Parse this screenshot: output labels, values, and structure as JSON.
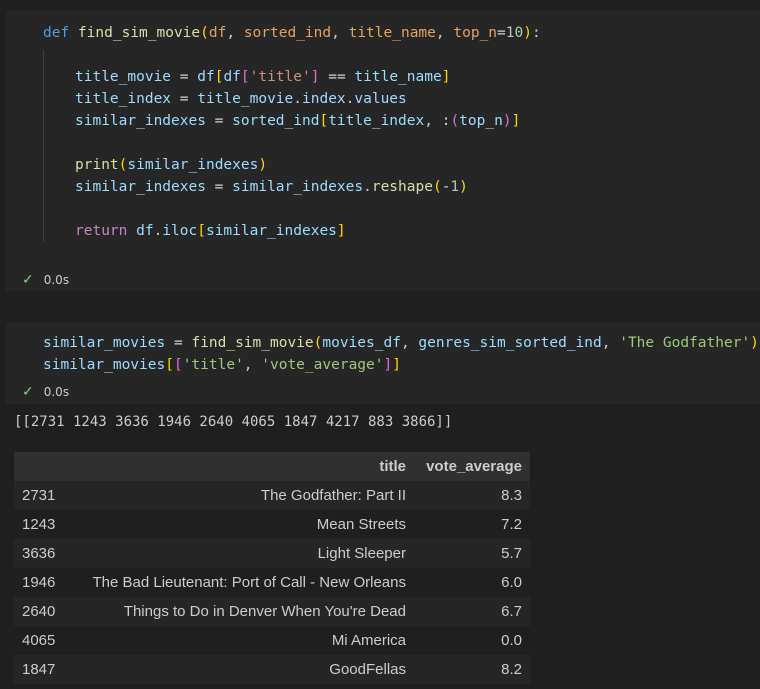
{
  "cell1": {
    "lines": [
      [
        [
          "kw",
          "def "
        ],
        [
          "fn",
          "find_sim_movie"
        ],
        [
          "br1",
          "("
        ],
        [
          "par",
          "df"
        ],
        [
          "txt",
          ", "
        ],
        [
          "par",
          "sorted_ind"
        ],
        [
          "txt",
          ", "
        ],
        [
          "par",
          "title_name"
        ],
        [
          "txt",
          ", "
        ],
        [
          "par",
          "top_n"
        ],
        [
          "op",
          "="
        ],
        [
          "num",
          "10"
        ],
        [
          "br1",
          ")"
        ],
        [
          "txt",
          ":"
        ]
      ],
      [
        [
          "pm",
          "title_movie"
        ],
        [
          "op",
          " = "
        ],
        [
          "pm",
          "df"
        ],
        [
          "br1",
          "["
        ],
        [
          "pm",
          "df"
        ],
        [
          "br2",
          "["
        ],
        [
          "str",
          "'title'"
        ],
        [
          "br2",
          "]"
        ],
        [
          "op",
          " == "
        ],
        [
          "pm",
          "title_name"
        ],
        [
          "br1",
          "]"
        ]
      ],
      [
        [
          "pm",
          "title_index"
        ],
        [
          "op",
          " = "
        ],
        [
          "pm",
          "title_movie"
        ],
        [
          "txt",
          "."
        ],
        [
          "pm",
          "index"
        ],
        [
          "txt",
          "."
        ],
        [
          "pm",
          "values"
        ]
      ],
      [
        [
          "pm",
          "similar_indexes"
        ],
        [
          "op",
          " = "
        ],
        [
          "pm",
          "sorted_ind"
        ],
        [
          "br1",
          "["
        ],
        [
          "pm",
          "title_index"
        ],
        [
          "txt",
          ", "
        ],
        [
          "op",
          ":"
        ],
        [
          "br2",
          "("
        ],
        [
          "pm",
          "top_n"
        ],
        [
          "br2",
          ")"
        ],
        [
          "br1",
          "]"
        ]
      ],
      [
        [
          "fn",
          "print"
        ],
        [
          "br1",
          "("
        ],
        [
          "pm",
          "similar_indexes"
        ],
        [
          "br1",
          ")"
        ]
      ],
      [
        [
          "pm",
          "similar_indexes"
        ],
        [
          "op",
          " = "
        ],
        [
          "pm",
          "similar_indexes"
        ],
        [
          "txt",
          "."
        ],
        [
          "fn",
          "reshape"
        ],
        [
          "br1",
          "("
        ],
        [
          "op",
          "-"
        ],
        [
          "num",
          "1"
        ],
        [
          "br1",
          ")"
        ]
      ],
      [
        [
          "ctl",
          "return "
        ],
        [
          "pm",
          "df"
        ],
        [
          "txt",
          "."
        ],
        [
          "pm",
          "iloc"
        ],
        [
          "br1",
          "["
        ],
        [
          "pm",
          "similar_indexes"
        ],
        [
          "br1",
          "]"
        ]
      ]
    ],
    "status": "0.0s"
  },
  "cell2": {
    "lines": [
      [
        [
          "pm",
          "similar_movies"
        ],
        [
          "op",
          " = "
        ],
        [
          "fn",
          "find_sim_movie"
        ],
        [
          "br1",
          "("
        ],
        [
          "pm",
          "movies_df"
        ],
        [
          "txt",
          ", "
        ],
        [
          "pm",
          "genres_sim_sorted_ind"
        ],
        [
          "txt",
          ", "
        ],
        [
          "grn",
          "'The Godfather'"
        ],
        [
          "br1",
          ")"
        ]
      ],
      [
        [
          "pm",
          "similar_movies"
        ],
        [
          "br1",
          "["
        ],
        [
          "br2",
          "["
        ],
        [
          "grn",
          "'title'"
        ],
        [
          "txt",
          ", "
        ],
        [
          "grn",
          "'vote_average'"
        ],
        [
          "br2",
          "]"
        ],
        [
          "br1",
          "]"
        ]
      ]
    ],
    "status": "0.0s"
  },
  "output_text": "[[2731 1243 3636 1946 2640 4065 1847 4217  883 3866]]",
  "table": {
    "headers": [
      "",
      "title",
      "vote_average"
    ],
    "rows": [
      [
        "2731",
        "The Godfather: Part II",
        "8.3"
      ],
      [
        "1243",
        "Mean Streets",
        "7.2"
      ],
      [
        "3636",
        "Light Sleeper",
        "5.7"
      ],
      [
        "1946",
        "The Bad Lieutenant: Port of Call - New Orleans",
        "6.0"
      ],
      [
        "2640",
        "Things to Do in Denver When You're Dead",
        "6.7"
      ],
      [
        "4065",
        "Mi America",
        "0.0"
      ],
      [
        "1847",
        "GoodFellas",
        "8.2"
      ]
    ]
  }
}
